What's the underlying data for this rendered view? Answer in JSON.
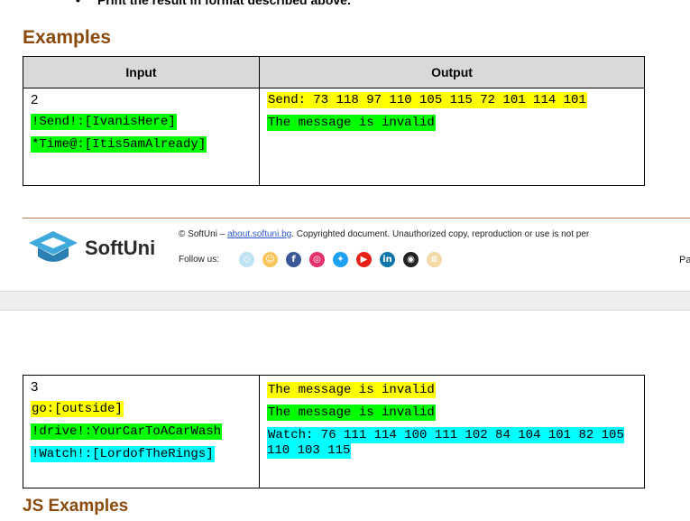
{
  "intro": {
    "bullet": "•",
    "text": "Print the result in format described above."
  },
  "examples_heading": "Examples",
  "table1": {
    "headers": [
      "Input",
      "Output"
    ],
    "input_first": "2",
    "inputs": [
      {
        "text": "!Send!:[IvanisHere]",
        "highlight": "green"
      },
      {
        "text": "*Time@:[Itis5amAlready]",
        "highlight": "green"
      }
    ],
    "outputs": [
      {
        "text": "Send: 73 118 97 110 105 115 72 101 114 101",
        "highlight": "yellow"
      },
      {
        "text": "The message is invalid",
        "highlight": "green"
      }
    ]
  },
  "footer": {
    "brand": "SoftUni",
    "copyright_prefix": "© SoftUni –",
    "copyright_link": "about.softuni.bg",
    "copyright_suffix": ". Copyrighted document. Unauthorized copy, reproduction or use is not per",
    "follow_label": "Follow us:",
    "page_label": "Pa",
    "social_icons": [
      {
        "name": "softuni-icon",
        "color": "#bfe3f2"
      },
      {
        "name": "softuni-kids-icon",
        "color": "#f6c65b"
      },
      {
        "name": "facebook-icon",
        "color": "#3b5998"
      },
      {
        "name": "instagram-icon",
        "color": "#e1306c"
      },
      {
        "name": "twitter-icon",
        "color": "#1da1f2"
      },
      {
        "name": "youtube-icon",
        "color": "#e62117"
      },
      {
        "name": "linkedin-icon",
        "color": "#0e76a8"
      },
      {
        "name": "github-icon",
        "color": "#222222"
      },
      {
        "name": "forum-icon",
        "color": "#f3d9a5"
      }
    ]
  },
  "table2": {
    "input_first": "3",
    "inputs": [
      {
        "text": "go:[outside]",
        "highlight": "yellow"
      },
      {
        "text": "!drive!:YourCarToACarWash",
        "highlight": "green"
      },
      {
        "text": "!Watch!:[LordofTheRings]",
        "highlight": "cyan"
      }
    ],
    "outputs": [
      {
        "text": "The message is invalid",
        "highlight": "yellow"
      },
      {
        "text": "The message is invalid",
        "highlight": "green"
      },
      {
        "text": "Watch: 76 111 114 100 111 102 84 104 101 82 105 110 103 115",
        "highlight": "cyan"
      }
    ]
  },
  "js_examples_heading": "JS Examples"
}
